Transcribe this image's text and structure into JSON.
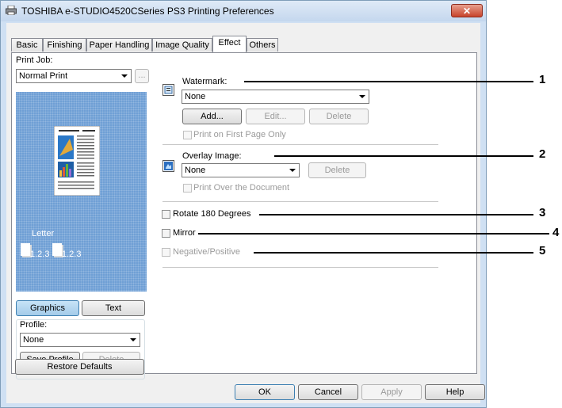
{
  "window": {
    "title": "TOSHIBA e-STUDIO4520CSeries PS3 Printing Preferences",
    "close_label": "✕"
  },
  "tabs": [
    {
      "label": "Basic"
    },
    {
      "label": "Finishing"
    },
    {
      "label": "Paper Handling"
    },
    {
      "label": "Image Quality"
    },
    {
      "label": "Effect"
    },
    {
      "label": "Others"
    }
  ],
  "left": {
    "print_job_label": "Print Job:",
    "print_job_value": "Normal Print",
    "more_button": "...",
    "paper_label": "Letter",
    "page_order_1": "1.2.3",
    "page_order_2": "1.2.3",
    "graphics_button": "Graphics",
    "text_button": "Text",
    "profile_label": "Profile:",
    "profile_value": "None",
    "save_profile_button": "Save Profile",
    "delete_button": "Delete",
    "restore_defaults_button": "Restore Defaults"
  },
  "watermark": {
    "label": "Watermark:",
    "value": "None",
    "add_button": "Add...",
    "edit_button": "Edit...",
    "delete_button": "Delete",
    "first_page_only": "Print on First Page Only"
  },
  "overlay": {
    "label": "Overlay Image:",
    "value": "None",
    "delete_button": "Delete",
    "print_over": "Print Over the Document"
  },
  "options": {
    "rotate": "Rotate 180 Degrees",
    "mirror": "Mirror",
    "negative_positive": "Negative/Positive"
  },
  "footer": {
    "ok": "OK",
    "cancel": "Cancel",
    "apply": "Apply",
    "help": "Help"
  },
  "callouts": [
    "1",
    "2",
    "3",
    "4",
    "5"
  ]
}
